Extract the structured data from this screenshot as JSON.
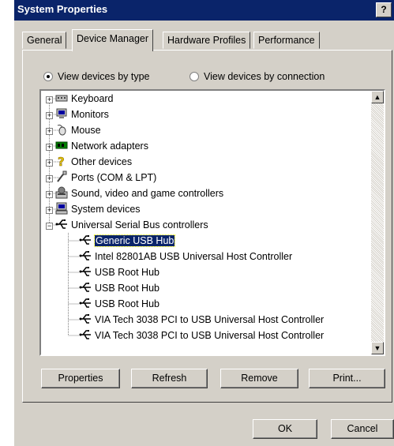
{
  "window": {
    "title": "System Properties",
    "help_label": "?"
  },
  "tabs": [
    {
      "label": "General"
    },
    {
      "label": "Device Manager"
    },
    {
      "label": "Hardware Profiles"
    },
    {
      "label": "Performance"
    }
  ],
  "view_options": {
    "by_type": "View devices by type",
    "by_connection": "View devices by connection",
    "selected": "by_type"
  },
  "tree": {
    "categories": [
      {
        "label": "Keyboard",
        "icon": "keyboard-icon"
      },
      {
        "label": "Monitors",
        "icon": "monitor-icon"
      },
      {
        "label": "Mouse",
        "icon": "mouse-icon"
      },
      {
        "label": "Network adapters",
        "icon": "network-adapter-icon"
      },
      {
        "label": "Other devices",
        "icon": "question-mark-icon"
      },
      {
        "label": "Ports (COM & LPT)",
        "icon": "port-icon"
      },
      {
        "label": "Sound, video and game controllers",
        "icon": "sound-icon"
      },
      {
        "label": "System devices",
        "icon": "computer-icon"
      },
      {
        "label": "Universal Serial Bus controllers",
        "icon": "usb-icon"
      }
    ],
    "usb_children": [
      {
        "label": "Generic USB Hub",
        "selected": true
      },
      {
        "label": "Intel 82801AB USB Universal Host Controller"
      },
      {
        "label": "USB Root Hub"
      },
      {
        "label": "USB Root Hub"
      },
      {
        "label": "USB Root Hub"
      },
      {
        "label": "VIA Tech 3038 PCI to USB Universal Host Controller"
      },
      {
        "label": "VIA Tech 3038 PCI to USB Universal Host Controller"
      }
    ]
  },
  "actions": {
    "properties": "Properties",
    "refresh": "Refresh",
    "remove": "Remove",
    "print": "Print..."
  },
  "dialog_buttons": {
    "ok": "OK",
    "cancel": "Cancel"
  },
  "colors": {
    "title_bar": "#0a246a",
    "face": "#d4d0c8",
    "selection": "#0a246a"
  }
}
